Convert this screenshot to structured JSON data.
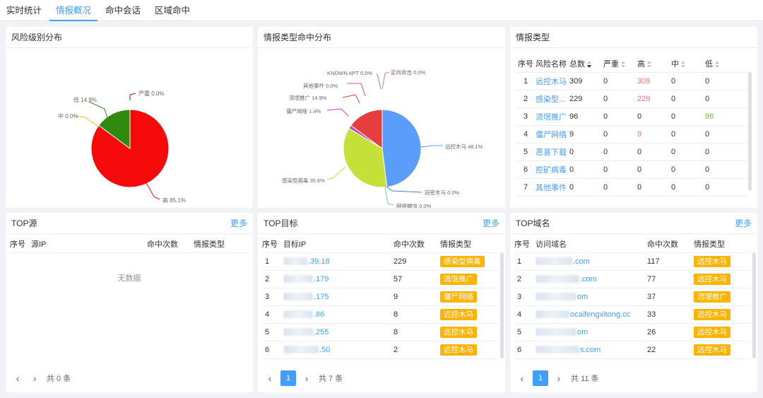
{
  "tabs": [
    "实时统计",
    "情报概况",
    "命中会话",
    "区域命中"
  ],
  "risk_panel": {
    "title": "风险级别分布",
    "labels": [
      "严重 0.0%",
      "低 14.9%",
      "中 0.0%",
      "高 85.1%"
    ]
  },
  "type_pie_panel": {
    "title": "情报类型命中分布",
    "labels": [
      "KNOWN APT 0.0%",
      "定向攻击 0.0%",
      "其他事件 0.0%",
      "流氓推广 14.9%",
      "僵尸网络 1.4%",
      "远控木马 48.1%",
      "感染型病毒 35.6%",
      "窃密木马 0.0%",
      "网络蠕虫 0.0%"
    ]
  },
  "chart_data": [
    {
      "type": "pie",
      "title": "风险级别分布",
      "slices": [
        {
          "label": "高",
          "value": 85.1,
          "color": "#f50a0a"
        },
        {
          "label": "低",
          "value": 14.9,
          "color": "#2e8b0d"
        },
        {
          "label": "中",
          "value": 0.0,
          "color": "#f0c000"
        },
        {
          "label": "严重",
          "value": 0.0,
          "color": "#a01010"
        }
      ]
    },
    {
      "type": "pie",
      "title": "情报类型命中分布",
      "slices": [
        {
          "label": "远控木马",
          "value": 48.1,
          "color": "#5b9dfb"
        },
        {
          "label": "窃密木马",
          "value": 0.0,
          "color": "#4a7bd8"
        },
        {
          "label": "网络蠕虫",
          "value": 0.0,
          "color": "#7ab8f5"
        },
        {
          "label": "感染型病毒",
          "value": 35.6,
          "color": "#c6e03a"
        },
        {
          "label": "僵尸网络",
          "value": 1.4,
          "color": "#c33fc8"
        },
        {
          "label": "流氓推广",
          "value": 14.9,
          "color": "#e63d3d"
        },
        {
          "label": "其他事件",
          "value": 0.0,
          "color": "#d35a5a"
        },
        {
          "label": "KNOWN APT",
          "value": 0.0,
          "color": "#888888"
        },
        {
          "label": "定向攻击",
          "value": 0.0,
          "color": "#d070d0"
        }
      ]
    }
  ],
  "intel_type": {
    "title": "情报类型",
    "headers": [
      "序号",
      "风险名称",
      "总数",
      "严重",
      "高",
      "中",
      "低"
    ],
    "rows": [
      [
        "1",
        "远控木马",
        "309",
        "0",
        "309",
        "0",
        "0"
      ],
      [
        "2",
        "感染型...",
        "229",
        "0",
        "229",
        "0",
        "0"
      ],
      [
        "3",
        "流氓推广",
        "96",
        "0",
        "0",
        "0",
        "96"
      ],
      [
        "4",
        "僵尸网络",
        "9",
        "0",
        "9",
        "0",
        "0"
      ],
      [
        "5",
        "恶意下载",
        "0",
        "0",
        "0",
        "0",
        "0"
      ],
      [
        "6",
        "挖矿病毒",
        "0",
        "0",
        "0",
        "0",
        "0"
      ],
      [
        "7",
        "其他事件",
        "0",
        "0",
        "0",
        "0",
        "0"
      ]
    ]
  },
  "top_src": {
    "title": "TOP源",
    "more": "更多",
    "headers": [
      "序号",
      "源IP",
      "命中次数",
      "情报类型"
    ],
    "empty": "无数据",
    "total": "共 0 条"
  },
  "top_dst": {
    "title": "TOP目标",
    "more": "更多",
    "headers": [
      "序号",
      "目标IP",
      "命中次数",
      "情报类型"
    ],
    "rows": [
      [
        "1",
        ".39.18",
        "229",
        "感染型病毒"
      ],
      [
        "2",
        ".179",
        "57",
        "流氓推广"
      ],
      [
        "3",
        ".175",
        "9",
        "僵尸网络"
      ],
      [
        "4",
        ".86",
        "8",
        "远控木马"
      ],
      [
        "5",
        ".255",
        "8",
        "远控木马"
      ],
      [
        "6",
        ".50",
        "2",
        "远控木马"
      ]
    ],
    "page": "1",
    "total": "共 7 条"
  },
  "top_domain": {
    "title": "TOP域名",
    "more": "更多",
    "headers": [
      "序号",
      "访问域名",
      "命中次数",
      "情报类型"
    ],
    "rows": [
      [
        "1",
        ".com",
        "117",
        "远控木马"
      ],
      [
        "2",
        ".com",
        "77",
        "远控木马"
      ],
      [
        "3",
        "om",
        "37",
        "流氓推广"
      ],
      [
        "4",
        "ocaifengxitong.cc",
        "33",
        "远控木马"
      ],
      [
        "5",
        "om",
        "26",
        "远控木马"
      ],
      [
        "6",
        "s.com",
        "22",
        "远控木马"
      ]
    ],
    "page": "1",
    "total": "共 11 条"
  }
}
